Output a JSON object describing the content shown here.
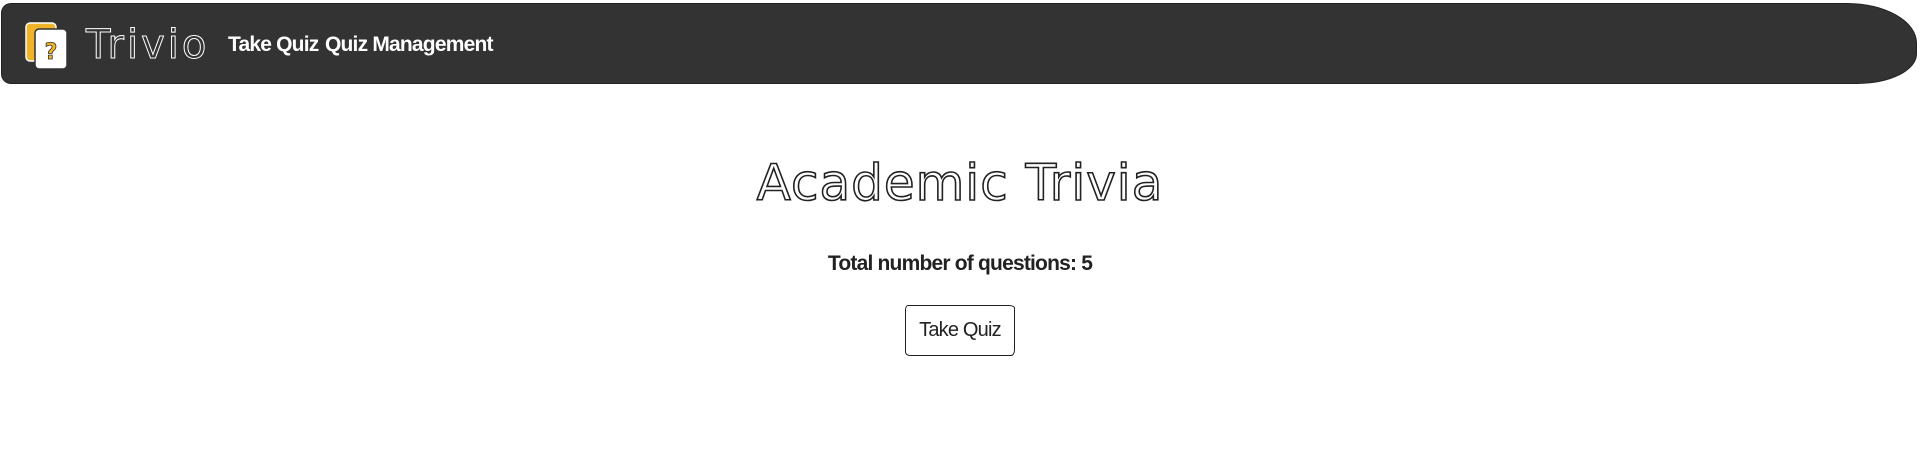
{
  "navbar": {
    "brand": "Trivio",
    "logo_icon": "question-cards-icon",
    "links": [
      {
        "label": "Take Quiz"
      },
      {
        "label": "Quiz Management"
      }
    ]
  },
  "main": {
    "title": "Academic Trivia",
    "question_count_label": "Total number of questions:",
    "question_count": "5",
    "take_quiz_button": "Take Quiz"
  },
  "colors": {
    "navbar_bg": "#333333",
    "accent": "#f0b429",
    "text": "#222222"
  }
}
